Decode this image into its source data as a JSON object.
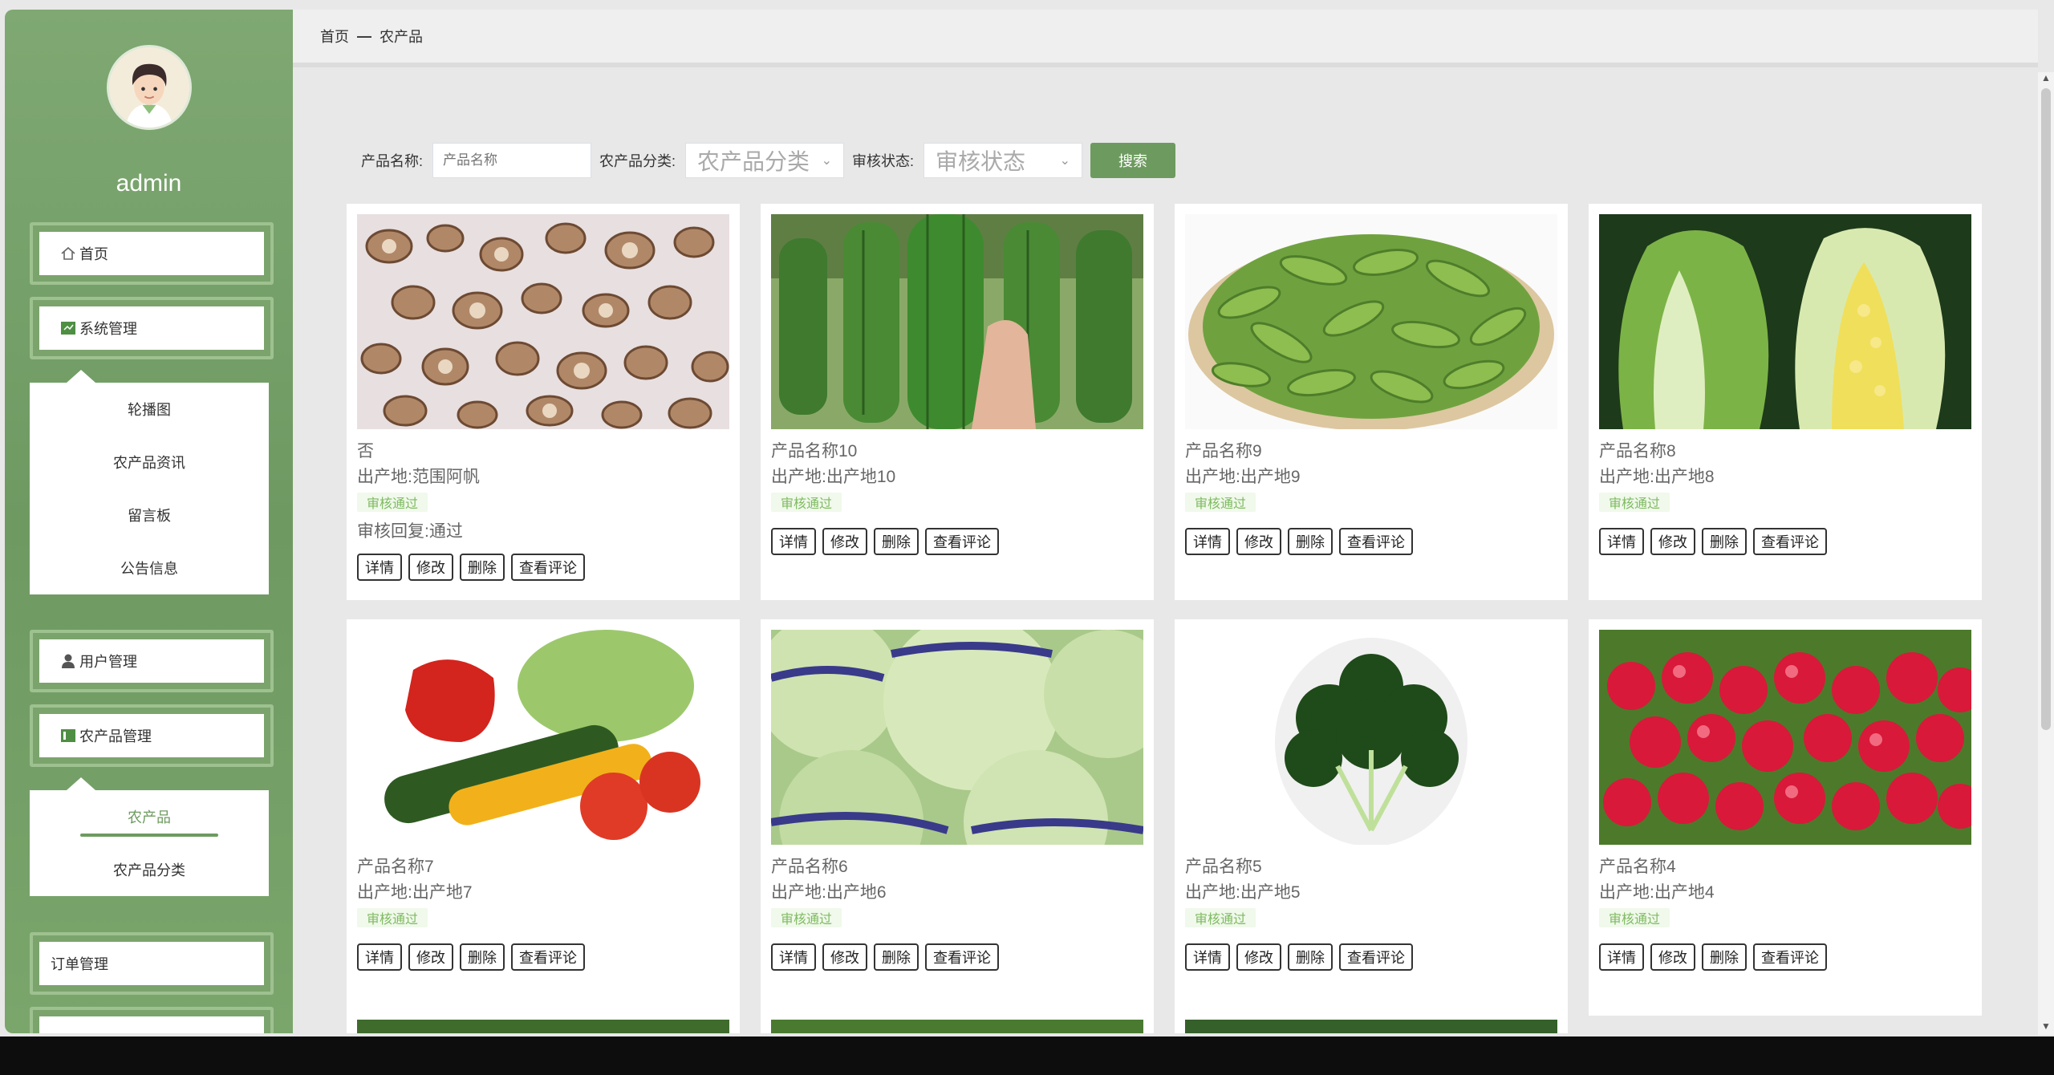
{
  "sidebar": {
    "username": "admin",
    "menu": {
      "home": "首页",
      "system": "系统管理",
      "user": "用户管理",
      "product": "农产品管理",
      "order": "订单管理"
    },
    "system_sub": [
      "轮播图",
      "农产品资讯",
      "留言板",
      "公告信息"
    ],
    "product_sub": [
      "农产品",
      "农产品分类"
    ]
  },
  "breadcrumb": {
    "home": "首页",
    "sep": "—",
    "current": "农产品"
  },
  "search": {
    "name_label": "产品名称:",
    "name_placeholder": "产品名称",
    "category_label": "农产品分类:",
    "category_placeholder": "农产品分类",
    "status_label": "审核状态:",
    "status_placeholder": "审核状态",
    "button": "搜索"
  },
  "card_actions": [
    "详情",
    "修改",
    "删除",
    "查看评论"
  ],
  "products": [
    {
      "name": "否",
      "origin": "出产地:范围阿帆",
      "badge": "审核通过",
      "reply": "审核回复:通过",
      "image": "herb-slices"
    },
    {
      "name": "产品名称10",
      "origin": "出产地:出产地10",
      "badge": "审核通过",
      "reply": "",
      "image": "luffa"
    },
    {
      "name": "产品名称9",
      "origin": "出产地:出产地9",
      "badge": "审核通过",
      "reply": "",
      "image": "edamame"
    },
    {
      "name": "产品名称8",
      "origin": "出产地:出产地8",
      "badge": "审核通过",
      "reply": "",
      "image": "napa-cabbage"
    },
    {
      "name": "产品名称7",
      "origin": "出产地:出产地7",
      "badge": "审核通过",
      "reply": "",
      "image": "mixed-vegetables"
    },
    {
      "name": "产品名称6",
      "origin": "出产地:出产地6",
      "badge": "审核通过",
      "reply": "",
      "image": "cabbage"
    },
    {
      "name": "产品名称5",
      "origin": "出产地:出产地5",
      "badge": "审核通过",
      "reply": "",
      "image": "tatsoi"
    },
    {
      "name": "产品名称4",
      "origin": "出产地:出产地4",
      "badge": "审核通过",
      "reply": "",
      "image": "radish"
    }
  ],
  "colors": {
    "accent": "#6d9b5f",
    "sidebar": "#7aa66c",
    "badge_bg": "#f0f9eb",
    "badge_text": "#7fba61"
  }
}
